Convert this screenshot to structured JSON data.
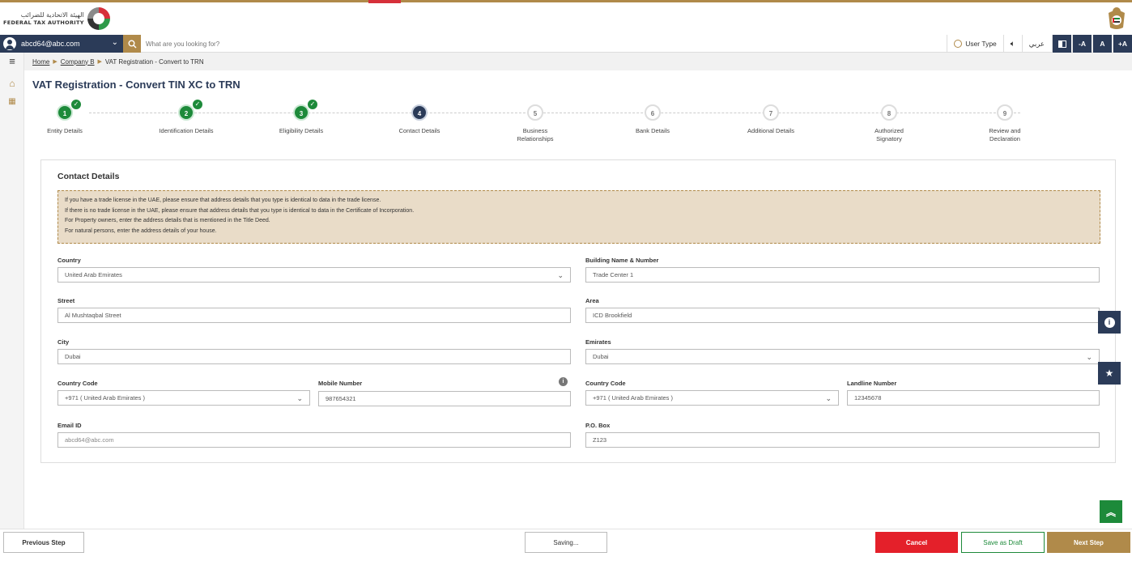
{
  "brand": {
    "arabic_name": "الهيئة الاتحادية للضرائب",
    "english_name": "FEDERAL TAX AUTHORITY"
  },
  "navbar": {
    "user_email": "abcd64@abc.com",
    "search_placeholder": "What are you looking for?",
    "user_type_label": "User Type",
    "language_label": "عربي",
    "font_decrease": "-A",
    "font_normal": "A",
    "font_increase": "+A"
  },
  "breadcrumb": {
    "items": [
      "Home",
      "Company B",
      "VAT Registration - Convert to TRN"
    ]
  },
  "page_title": "VAT Registration - Convert TIN XC to TRN",
  "stepper": {
    "steps": [
      {
        "number": "1",
        "label": "Entity Details",
        "state": "done"
      },
      {
        "number": "2",
        "label": "Identification Details",
        "state": "done"
      },
      {
        "number": "3",
        "label": "Eligibility Details",
        "state": "done"
      },
      {
        "number": "4",
        "label": "Contact Details",
        "state": "active"
      },
      {
        "number": "5",
        "label": "Business Relationships",
        "state": "pending"
      },
      {
        "number": "6",
        "label": "Bank Details",
        "state": "pending"
      },
      {
        "number": "7",
        "label": "Additional Details",
        "state": "pending"
      },
      {
        "number": "8",
        "label": "Authorized Signatory",
        "state": "pending"
      },
      {
        "number": "9",
        "label": "Review and Declaration",
        "state": "pending"
      }
    ]
  },
  "form": {
    "title": "Contact Details",
    "notice": [
      "If you have a trade license in the UAE, please ensure that address details that you type is identical to data in the trade license.",
      "If there is no trade license in the UAE, please ensure that address details that you type is identical to data in the Certificate of Incorporation.",
      "For Property owners, enter the address details that is mentioned in the Title Deed.",
      "For natural persons, enter the address details of your house."
    ],
    "country": {
      "label": "Country",
      "value": "United Arab Emirates"
    },
    "building": {
      "label": "Building Name & Number",
      "value": "Trade Center 1"
    },
    "street": {
      "label": "Street",
      "value": "Al Mushtaqbal Street"
    },
    "area": {
      "label": "Area",
      "value": "ICD Brookfield"
    },
    "city": {
      "label": "City",
      "value": "Dubai"
    },
    "emirates": {
      "label": "Emirates",
      "value": "Dubai"
    },
    "mobile_country_code": {
      "label": "Country Code",
      "value": "+971 ( United Arab Emirates )"
    },
    "mobile_number": {
      "label": "Mobile Number",
      "value": "987654321"
    },
    "landline_country_code": {
      "label": "Country Code",
      "value": "+971 ( United Arab Emirates )"
    },
    "landline_number": {
      "label": "Landline Number",
      "value": "12345678"
    },
    "email": {
      "label": "Email ID",
      "value": "abcd64@abc.com"
    },
    "po_box": {
      "label": "P.O. Box",
      "value": "Z123"
    }
  },
  "footer": {
    "previous_label": "Previous Step",
    "saving_label": "Saving...",
    "cancel_label": "Cancel",
    "draft_label": "Save as Draft",
    "next_label": "Next Step"
  },
  "colors": {
    "navy": "#2b3b58",
    "gold": "#b08a4a",
    "green": "#1d8a3a",
    "red": "#e4202a",
    "notice_bg": "#e9dcc8"
  }
}
